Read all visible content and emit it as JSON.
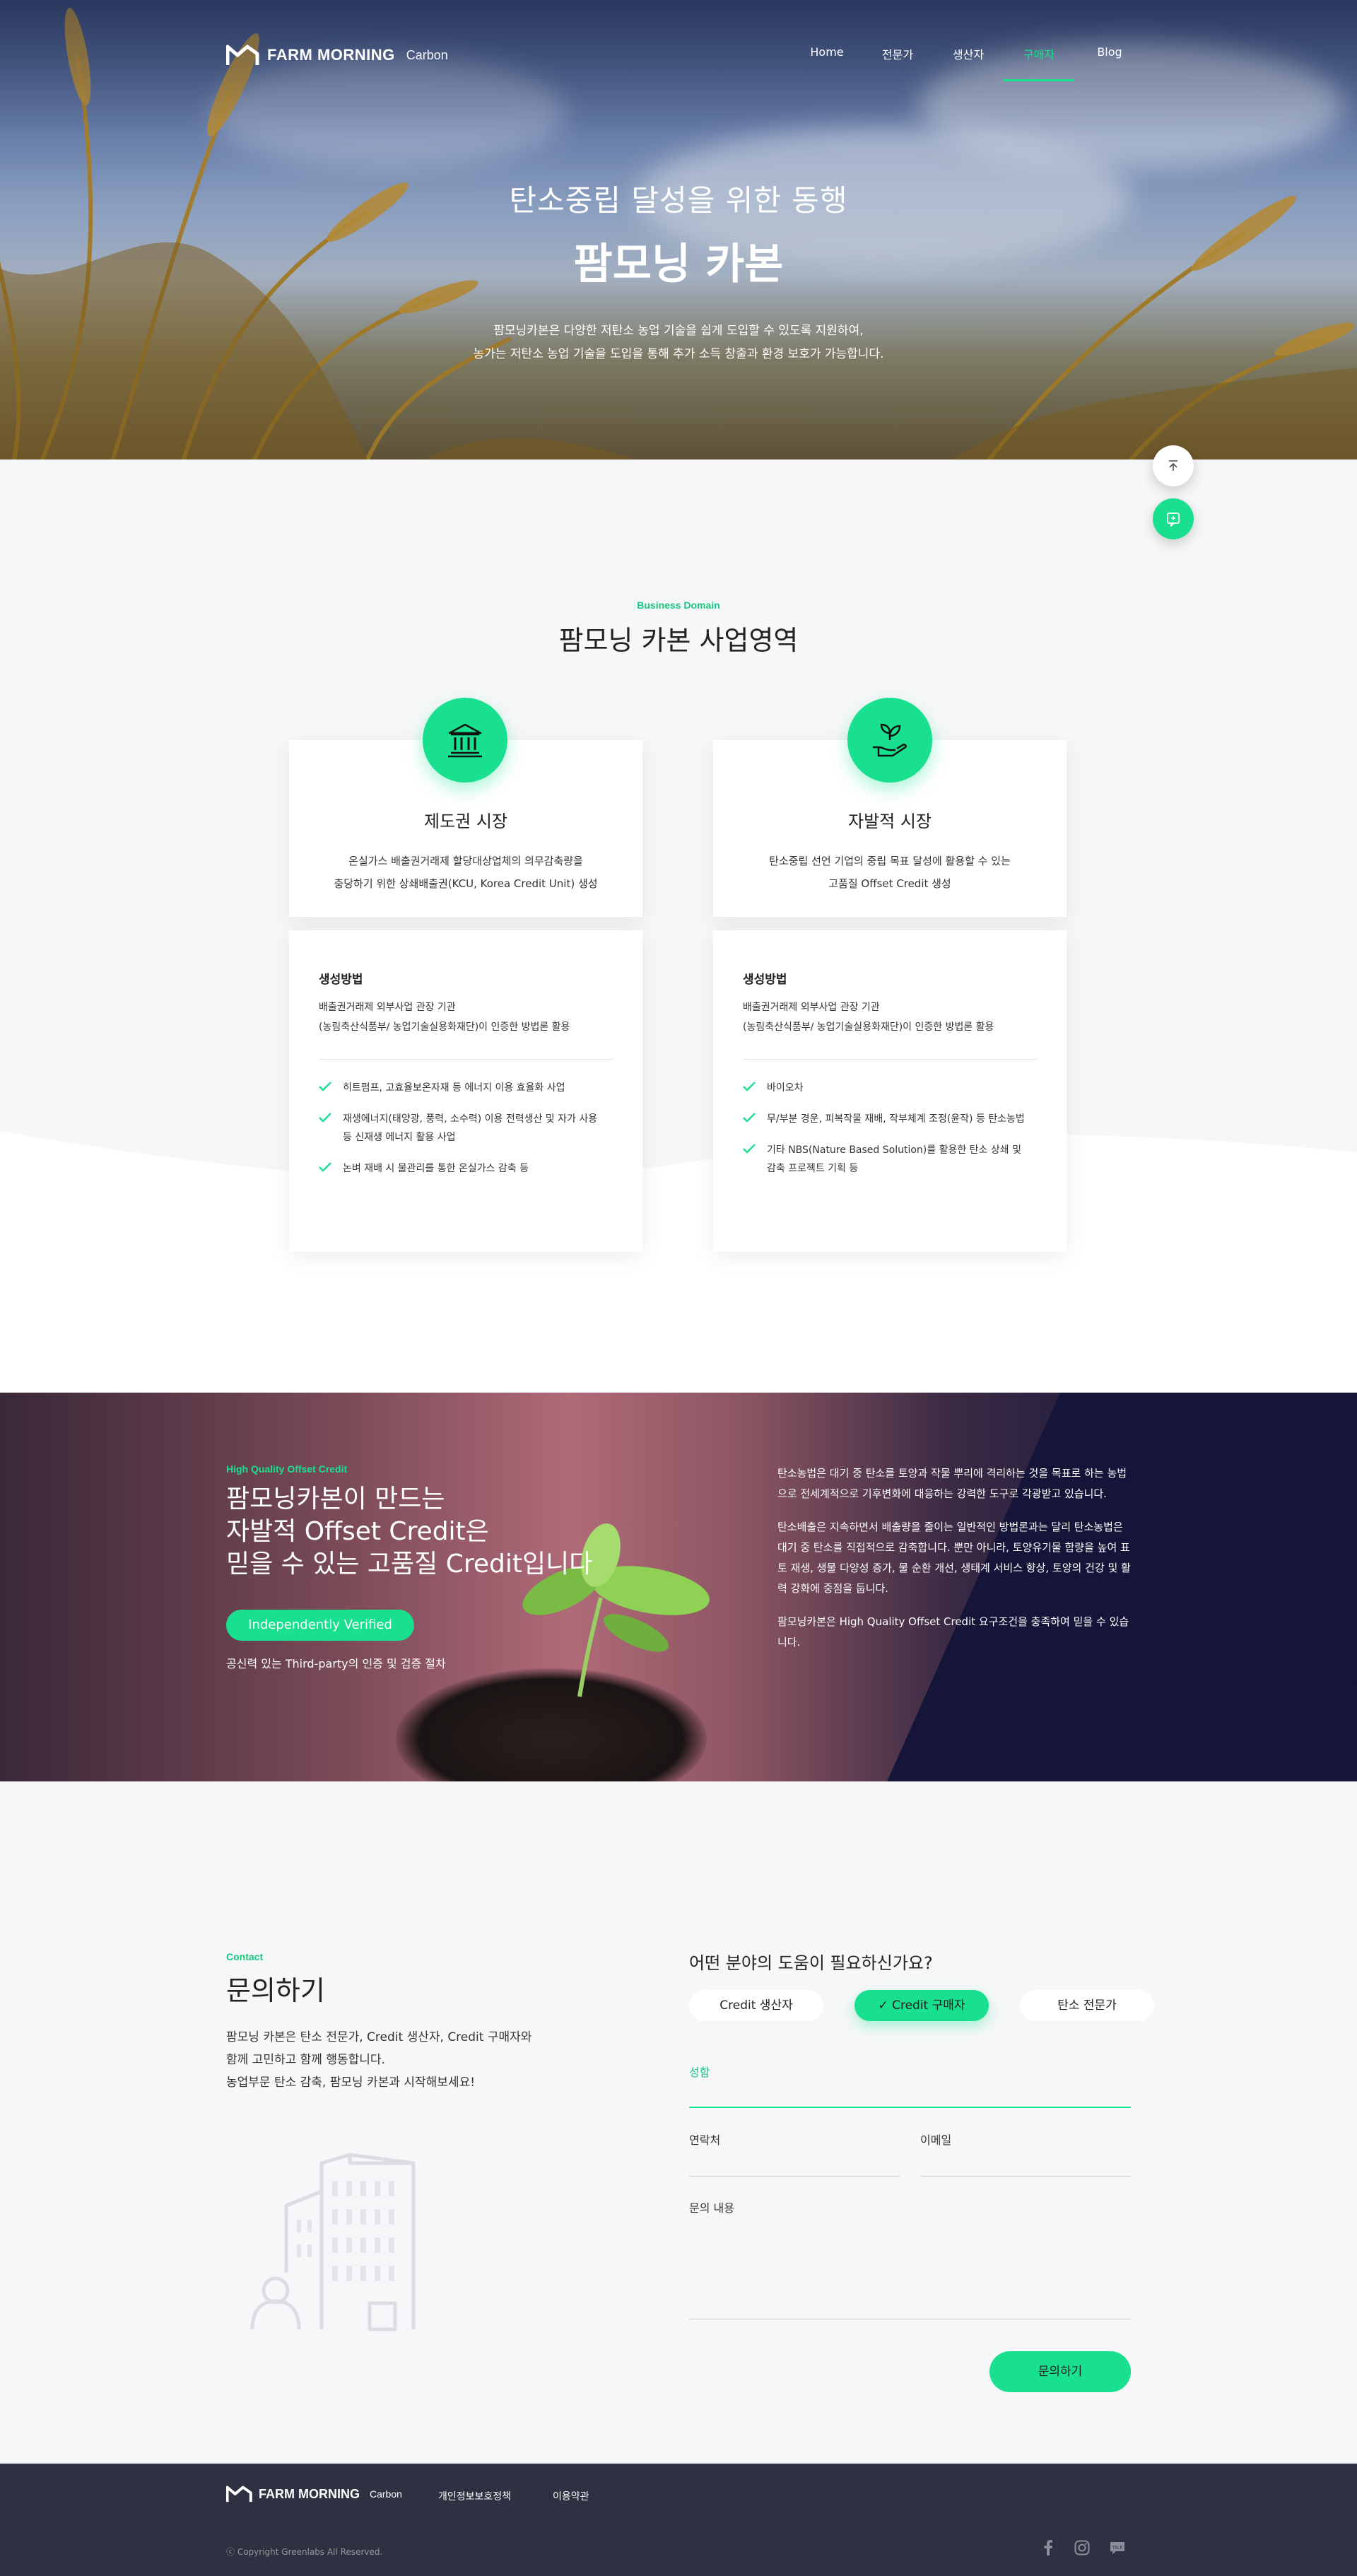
{
  "nav": {
    "logo_name": "FARM MORNING",
    "logo_sub": "Carbon",
    "items": [
      {
        "label": "Home"
      },
      {
        "label": "전문가"
      },
      {
        "label": "생산자"
      },
      {
        "label": "구매자"
      },
      {
        "label": "Blog"
      }
    ],
    "active_index": 3
  },
  "hero": {
    "line1": "탄소중립 달성을 위한 동행",
    "line2": "팜모닝 카본",
    "desc1": "팜모닝카본은 다양한 저탄소 농업 기술을 쉽게 도입할 수 있도록 지원하여,",
    "desc2": "농가는 저탄소 농업 기술을 도입을 통해 추가 소득 창출과 환경 보호가 가능합니다."
  },
  "floating": {
    "top_label": "⌃",
    "top_sub": "—"
  },
  "business": {
    "tag": "Business Domain",
    "title": "팜모닝 카본 사업영역",
    "cards": [
      {
        "title": "제도권 시장",
        "desc1": "온실가스 배출권거래제 할당대상업체의 의무감축량을",
        "desc2": "충당하기 위한 상쇄배출권(KCU, Korea Credit Unit) 생성",
        "method_title": "생성방법",
        "method1": "배출권거래제 외부사업 관장 기관",
        "method2": "(농림축산식품부/ 농업기술실용화재단)이 인증한 방법론 활용",
        "items": [
          "히트펌프, 고효율보온자재 등 에너지 이용 효율화 사업",
          "재생에너지(태양광, 풍력, 소수력) 이용 전력생산 및 자가 사용 등 신재생 에너지 활용 사업",
          "논벼 재배 시 물관리를 통한 온실가스 감축 등"
        ]
      },
      {
        "title": "자발적 시장",
        "desc1": "탄소중립 선언 기업의 중립 목표 달성에 활용할 수 있는",
        "desc2": "고품질 Offset Credit 생성",
        "method_title": "생성방법",
        "method1": "배출권거래제 외부사업 관장 기관",
        "method2": "(농림축산식품부/ 농업기술실용화재단)이 인증한 방법론 활용",
        "items": [
          "바이오차",
          "무/부분 경운, 피복작물 재배, 작부체계 조정(윤작) 등 탄소농법",
          "기타 NBS(Nature Based Solution)를 활용한 탄소 상쇄 및 감축 프로젝트 기획 등"
        ]
      }
    ]
  },
  "offset": {
    "tag": "High Quality Offset Credit",
    "h1": "팜모닝카본이 만드는",
    "h2": "자발적 Offset Credit은",
    "h3": "믿을 수 있는 고품질 Credit입니다",
    "button": "Independently  Verified",
    "sub": "공신력 있는 Third-party의 인증 및 검증 절차",
    "p1": "탄소농법은 대기 중 탄소를 토양과 작물 뿌리에 격리하는 것을 목표로 하는 농법으로 전세계적으로 기후변화에 대응하는 강력한 도구로 각광받고 있습니다.",
    "p2": "탄소배출은 지속하면서 배출량을 줄이는 일반적인 방법론과는 달리 탄소농법은 대기 중 탄소를 직접적으로 감축합니다. 뿐만 아니라, 토양유기물 함량을 높여 표토 재생, 생물 다양성 증가, 물 순환 개선, 생태계 서비스 향상, 토양의 건강 및 활력 강화에 중점을 둡니다.",
    "p3": "팜모닝카본은 High Quality Offset Credit 요구조건을 충족하여 믿을 수 있습니다."
  },
  "contact": {
    "tag": "Contact",
    "title": "문의하기",
    "desc1": "팜모닝 카본은 탄소 전문가, Credit 생산자, Credit 구매자와",
    "desc2": "함께 고민하고 함께 행동합니다.",
    "desc3": "농업부문 탄소 감축, 팜모닝 카본과 시작해보세요!",
    "question": "어떤 분야의 도움이 필요하신가요?",
    "chips": [
      {
        "label": "Credit 생산자"
      },
      {
        "label": "Credit 구매자"
      },
      {
        "label": "탄소 전문가"
      }
    ],
    "selected_chip": 1,
    "name_label": "성함",
    "phone_label": "연락처",
    "email_label": "이메일",
    "message_label": "문의 내용",
    "submit": "문의하기"
  },
  "footer": {
    "logo_name": "FARM MORNING",
    "logo_sub": "Carbon",
    "link1": "개인정보보호정책",
    "link2": "이용약관",
    "copyright": "ⓒ Copyright Greenlabs All Reserved.",
    "social": [
      "facebook-icon",
      "instagram-icon",
      "talk-icon"
    ]
  },
  "colors": {
    "accent": "#19e08f",
    "footer_bg": "#2d3141",
    "page_bg": "#f6f7f9"
  }
}
